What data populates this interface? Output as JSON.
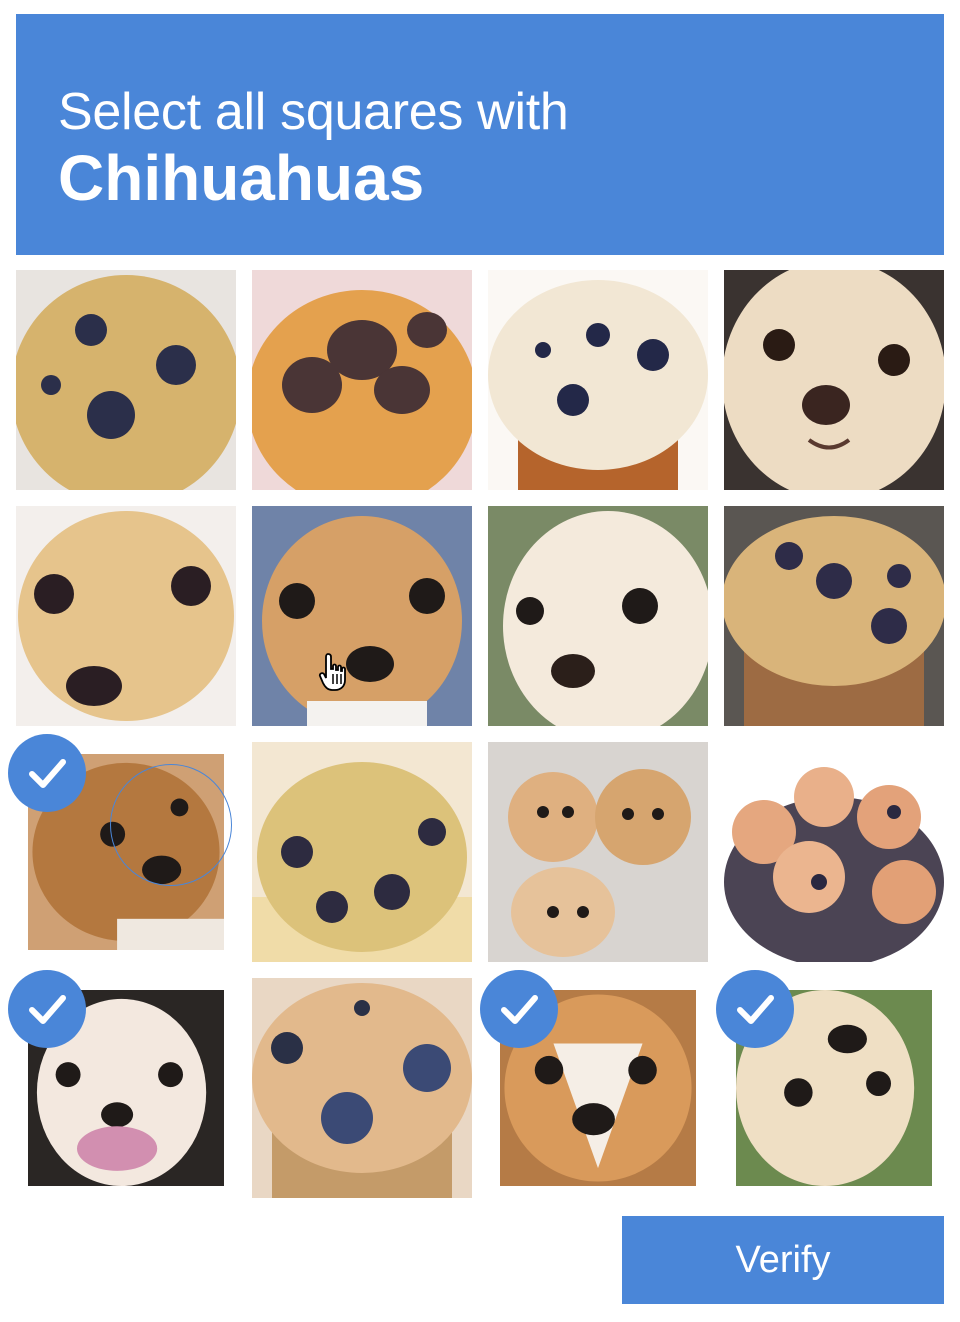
{
  "header": {
    "prompt": "Select all squares with",
    "target": "Chihuahuas"
  },
  "footer": {
    "verify_label": "Verify"
  },
  "colors": {
    "accent": "#4a86d8",
    "muffin_crust": "#d9a85c",
    "muffin_light": "#ecd29a",
    "blueberry": "#2b2f4a",
    "dog_fur": "#d9a26a",
    "dog_light": "#efe2cf"
  },
  "grid": {
    "rows": 4,
    "cols": 4,
    "tiles": [
      {
        "id": "t1",
        "kind": "muffin",
        "selected": false
      },
      {
        "id": "t2",
        "kind": "muffin",
        "selected": false
      },
      {
        "id": "t3",
        "kind": "muffin",
        "selected": false
      },
      {
        "id": "t4",
        "kind": "chihuahua",
        "selected": false
      },
      {
        "id": "t5",
        "kind": "muffin",
        "selected": false
      },
      {
        "id": "t6",
        "kind": "chihuahua",
        "selected": false
      },
      {
        "id": "t7",
        "kind": "chihuahua",
        "selected": false
      },
      {
        "id": "t8",
        "kind": "muffin",
        "selected": false
      },
      {
        "id": "t9",
        "kind": "chihuahua",
        "selected": true
      },
      {
        "id": "t10",
        "kind": "muffin",
        "selected": false
      },
      {
        "id": "t11",
        "kind": "chihuahua",
        "selected": false
      },
      {
        "id": "t12",
        "kind": "muffin",
        "selected": false
      },
      {
        "id": "t13",
        "kind": "chihuahua",
        "selected": true
      },
      {
        "id": "t14",
        "kind": "muffin",
        "selected": false
      },
      {
        "id": "t15",
        "kind": "chihuahua",
        "selected": true
      },
      {
        "id": "t16",
        "kind": "chihuahua",
        "selected": true
      }
    ]
  }
}
